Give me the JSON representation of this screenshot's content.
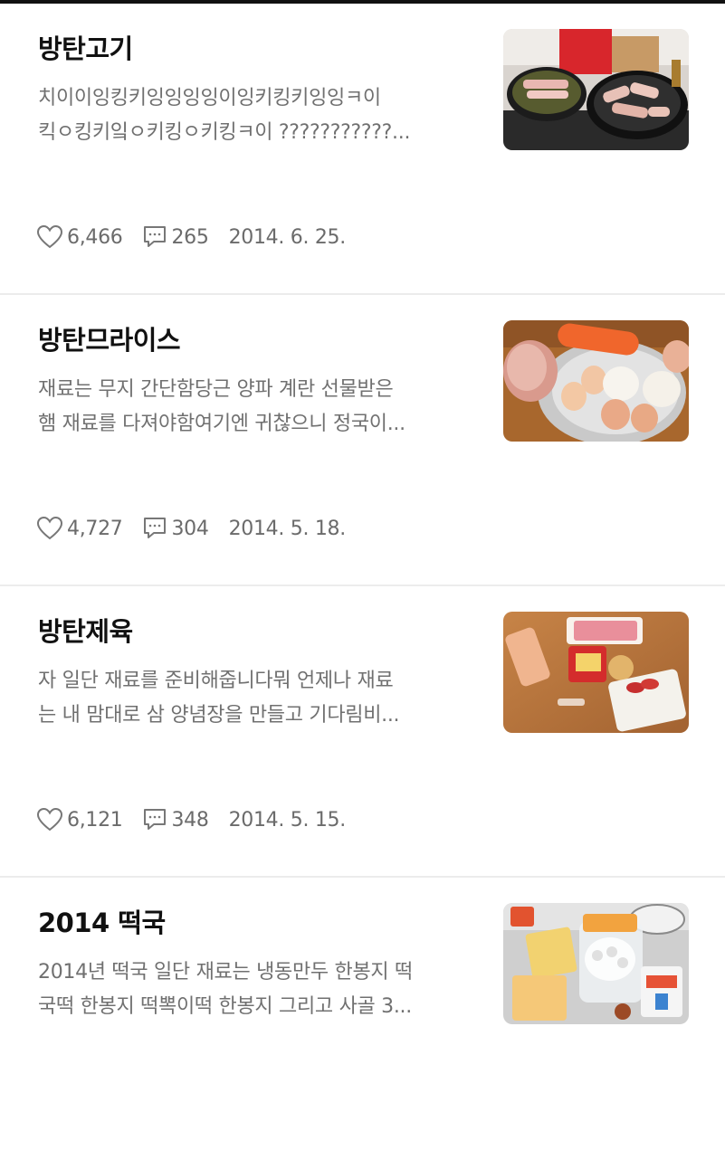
{
  "posts": [
    {
      "title": "방탄고기",
      "excerpt_line1": "치이이잉킹키잉잉잉잉이잉키킹키잉잉ㅋ이",
      "excerpt_line2": "킥ㅇ킹키잌ㅇ키킹ㅇ키킹ㅋ이 ???????????...",
      "likes": "6,466",
      "comments": "265",
      "date": "2014. 6. 25.",
      "thumbnail": "pork-belly-frying-pans"
    },
    {
      "title": "방탄므라이스",
      "excerpt_line1": "재료는 무지 간단함당근 양파 계란 선물받은",
      "excerpt_line2": "햄 재료를 다져야함여기엔 귀찮으니 정국이...",
      "likes": "4,727",
      "comments": "304",
      "date": "2014. 5. 18.",
      "thumbnail": "carrot-eggs-onion-bowl"
    },
    {
      "title": "방탄제육",
      "excerpt_line1": "자 일단 재료를 준비해줍니다뭐 언제나 재료",
      "excerpt_line2": "는 내 맘대로 삼 양념장을 만들고 기다림비...",
      "likes": "6,121",
      "comments": "348",
      "date": "2014. 5. 15.",
      "thumbnail": "pork-gochujang-ingredients"
    },
    {
      "title": "2014 떡국",
      "excerpt_line1": "2014년 떡국 일단 재료는 냉동만두 한봉지 떡",
      "excerpt_line2": "국떡 한봉지 떡뽁이떡 한봉지 그리고 사골 3...",
      "likes": "",
      "comments": "",
      "date": "",
      "thumbnail": "rice-cake-dumpling-packages"
    }
  ],
  "icons": {
    "like": "heart-outline-icon",
    "comment": "speech-bubble-icon"
  },
  "colors": {
    "title": "#111111",
    "excerpt": "#707070",
    "meta": "#6b6b6b",
    "divider": "#ececec"
  }
}
